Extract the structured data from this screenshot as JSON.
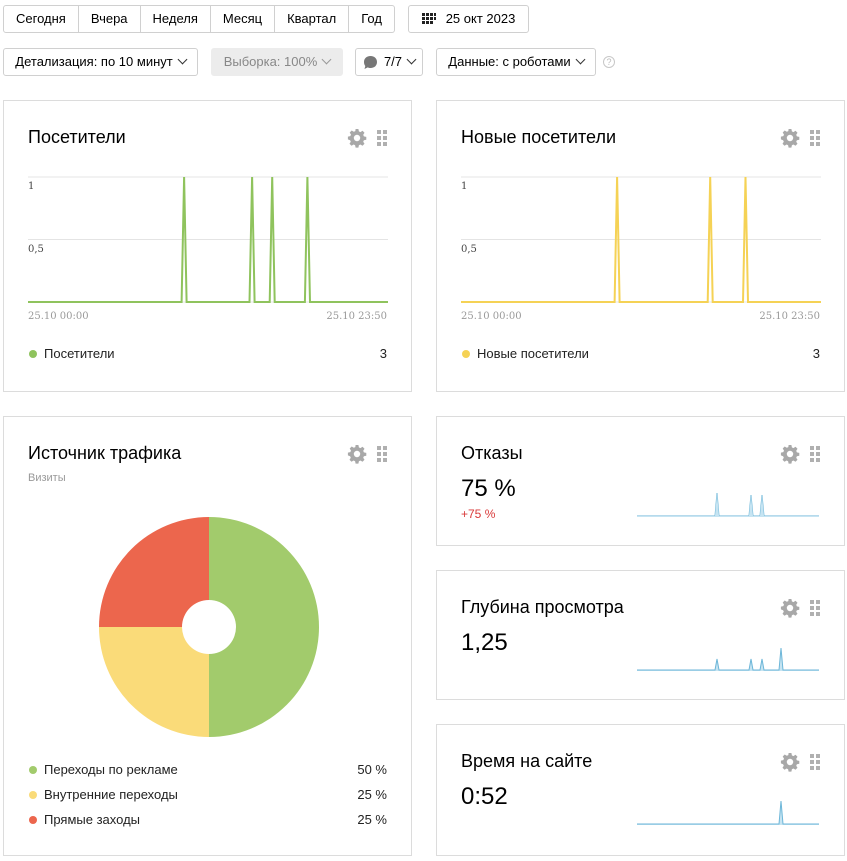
{
  "toolbar": {
    "periods": [
      "Сегодня",
      "Вчера",
      "Неделя",
      "Месяц",
      "Квартал",
      "Год"
    ],
    "date": "25 окт 2023",
    "detail": "Детализация: по 10 минут",
    "sample": "Выборка: 100%",
    "segments": "7/7",
    "data_mode": "Данные: с роботами",
    "help": "?"
  },
  "visitors": {
    "title": "Посетители",
    "y_ticks": [
      "1",
      "0,5"
    ],
    "x_start": "25.10 00:00",
    "x_end": "25.10 23:50",
    "legend": "Посетители",
    "value": "3",
    "color": "#8fc35d"
  },
  "new_visitors": {
    "title": "Новые посетители",
    "y_ticks": [
      "1",
      "0,5"
    ],
    "x_start": "25.10 00:00",
    "x_end": "25.10 23:50",
    "legend": "Новые посетители",
    "value": "3",
    "color": "#f5d255"
  },
  "traffic": {
    "title": "Источник трафика",
    "subtitle": "Визиты",
    "items": [
      {
        "label": "Переходы по рекламе",
        "value": "50 %",
        "pct": 50,
        "color": "#a2cb6c"
      },
      {
        "label": "Внутренние переходы",
        "value": "25 %",
        "pct": 25,
        "color": "#fadb79"
      },
      {
        "label": "Прямые заходы",
        "value": "25 %",
        "pct": 25,
        "color": "#ec664d"
      }
    ]
  },
  "bounce": {
    "title": "Отказы",
    "value": "75 %",
    "delta": "+75 %",
    "delta_color": "#d93a3a"
  },
  "depth": {
    "title": "Глубина просмотра",
    "value": "1,25"
  },
  "time": {
    "title": "Время на сайте",
    "value": "0:52"
  },
  "chart_data": [
    {
      "type": "line",
      "title": "Посетители",
      "x": [
        0,
        61,
        62,
        63,
        88,
        89,
        90,
        96,
        97,
        98,
        110,
        111,
        112,
        143
      ],
      "series": [
        {
          "name": "Посетители",
          "values": [
            0,
            0,
            1,
            0,
            0,
            1,
            0,
            0,
            1,
            0,
            0,
            1,
            0,
            0
          ]
        }
      ],
      "ylim": [
        0,
        1
      ]
    },
    {
      "type": "line",
      "title": "Новые посетители",
      "x": [
        0,
        61,
        62,
        63,
        98,
        99,
        100,
        112,
        113,
        114,
        143
      ],
      "series": [
        {
          "name": "Новые посетители",
          "values": [
            0,
            0,
            1,
            0,
            0,
            1,
            0,
            0,
            1,
            0,
            0
          ]
        }
      ],
      "ylim": [
        0,
        1
      ]
    }
  ]
}
